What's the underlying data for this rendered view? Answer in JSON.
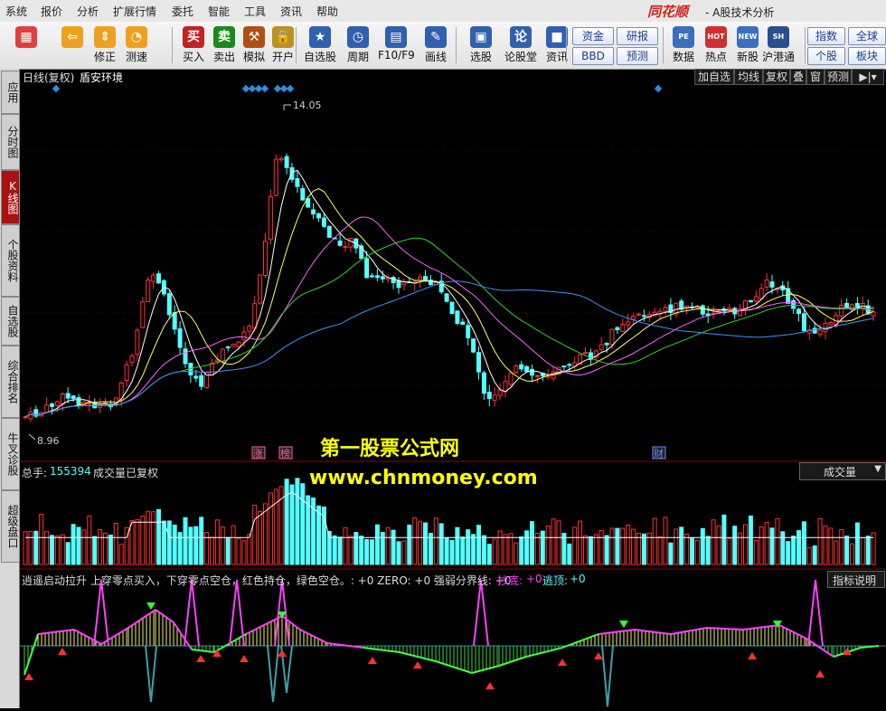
{
  "menu": [
    "系统",
    "报价",
    "分析",
    "扩展行情",
    "委托",
    "智能",
    "工具",
    "资讯",
    "帮助"
  ],
  "brand": "同花顺",
  "app_title": "- A股技术分析",
  "toolbar": [
    {
      "label": "",
      "icon": "grid-icon",
      "color": "#e04040"
    },
    {
      "label": "",
      "icon": "back-arrow-icon",
      "color": "#f0a020"
    },
    {
      "label": "修正",
      "icon": "up-down-arrow-icon",
      "color": "#f0a020"
    },
    {
      "label": "测速",
      "icon": "speed-icon",
      "color": "#f0a020"
    },
    {
      "label": "买入",
      "icon": "buy-icon",
      "color": "#c62020",
      "glyph": "买"
    },
    {
      "label": "卖出",
      "icon": "sell-icon",
      "color": "#1a8a1a",
      "glyph": "卖"
    },
    {
      "label": "模拟",
      "icon": "hammer-icon",
      "color": "#b05010"
    },
    {
      "label": "开户",
      "icon": "lock-icon",
      "color": "#c09020"
    },
    {
      "label": "自选股",
      "icon": "star-icon",
      "color": "#3060b0"
    },
    {
      "label": "周期",
      "icon": "clock-icon",
      "color": "#3060b0"
    },
    {
      "label": "F10/F9",
      "icon": "f10-icon",
      "color": "#3060b0"
    },
    {
      "label": "画线",
      "icon": "pencil-icon",
      "color": "#3060b0"
    },
    {
      "label": "选股",
      "icon": "screen-icon",
      "color": "#3060b0"
    },
    {
      "label": "论股堂",
      "icon": "talk-icon",
      "color": "#3060b0",
      "glyph": "论"
    },
    {
      "label": "资讯",
      "icon": "news-icon",
      "color": "#3060b0"
    }
  ],
  "small_buttons": [
    {
      "label": "资金"
    },
    {
      "label": "BBD"
    },
    {
      "label": "研报"
    },
    {
      "label": "预测"
    }
  ],
  "toolbar_right": [
    {
      "label": "数据",
      "icon": "pe-icon",
      "glyph": "PE"
    },
    {
      "label": "热点",
      "icon": "hot-icon",
      "glyph": "HOT"
    },
    {
      "label": "新股",
      "icon": "new-stock-icon",
      "glyph": "NEW"
    },
    {
      "label": "沪港通",
      "icon": "hk-connect-icon",
      "glyph": "SH HK"
    }
  ],
  "far_right_buttons": [
    {
      "label": "指数"
    },
    {
      "label": "全球"
    },
    {
      "label": "个股"
    },
    {
      "label": "板块"
    }
  ],
  "left_tabs": [
    {
      "label": "应用"
    },
    {
      "label": "分时图"
    },
    {
      "label": "K线图",
      "active": true
    },
    {
      "label": "个股资料"
    },
    {
      "label": "自选股"
    },
    {
      "label": "综合排名"
    },
    {
      "label": "牛叉诊股"
    },
    {
      "label": "超级盘口"
    }
  ],
  "kline_header": {
    "period": "日线(复权)",
    "stock_name": "盾安环境",
    "buttons": [
      "加自选",
      "均线",
      "复权",
      "叠",
      "窗",
      "预测"
    ],
    "high_label": "14.05",
    "low_label": "8.96"
  },
  "event_markers": [
    "涨",
    "榜",
    "财"
  ],
  "watermark": {
    "line1": "第一股票公式网",
    "line2": "www.chnmoney.com"
  },
  "volume_header": {
    "label": "总手:",
    "value": "155394",
    "note": "成交量已复权",
    "selector": "成交量"
  },
  "indicator_header": {
    "text": "逍遥启动拉升 上穿零点买入，下穿零点空仓，红色持仓，绿色空仓。: +0 ZERO: +0 强弱分界线: +0",
    "bottom_label": "抄底:",
    "bottom_value": "+0",
    "top_label": "逃顶:",
    "top_value": "+0",
    "explain": "指标说明"
  },
  "colors": {
    "up": "#ff3030",
    "down": "#54ffff",
    "ma5": "#ffffff",
    "ma10": "#ffff60",
    "ma20": "#ff60ff",
    "ma30": "#30d030",
    "ma60": "#4090ff",
    "marker": "#2a8fe0"
  }
}
